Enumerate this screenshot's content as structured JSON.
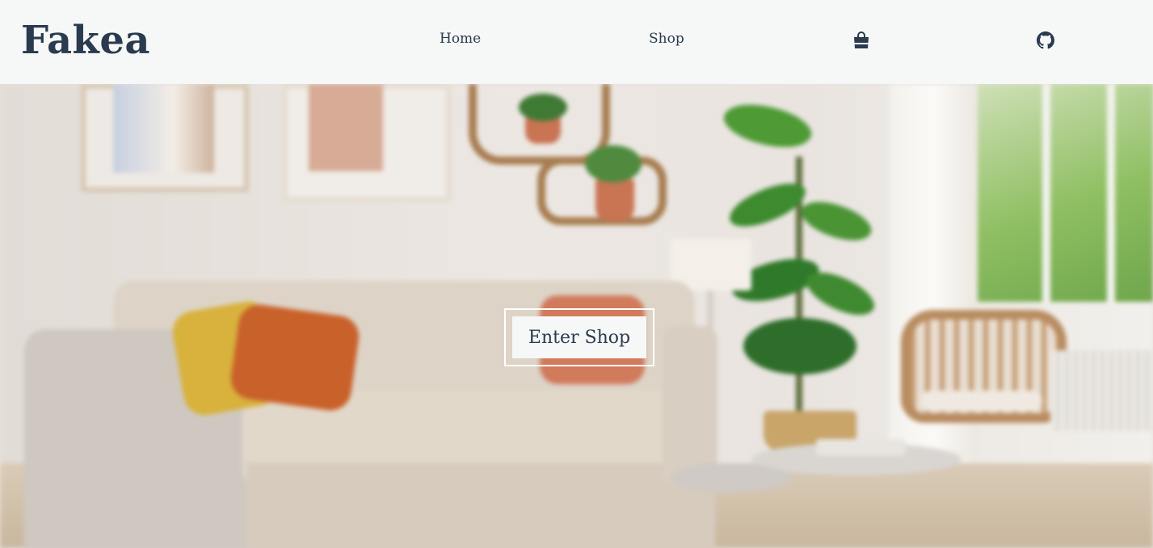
{
  "brand": {
    "name": "Fakea"
  },
  "nav": {
    "home_label": "Home",
    "shop_label": "Shop",
    "cart_icon": "shopping-bag-icon",
    "github_icon": "github-icon"
  },
  "hero": {
    "cta_label": "Enter Shop",
    "image_subject": "living room with sofa, cushions and plants"
  },
  "colors": {
    "primary_text": "#2a3a4f",
    "header_bg": "#f6f8f7",
    "button_bg": "#f6f8f7",
    "button_frame": "#ffffff"
  }
}
